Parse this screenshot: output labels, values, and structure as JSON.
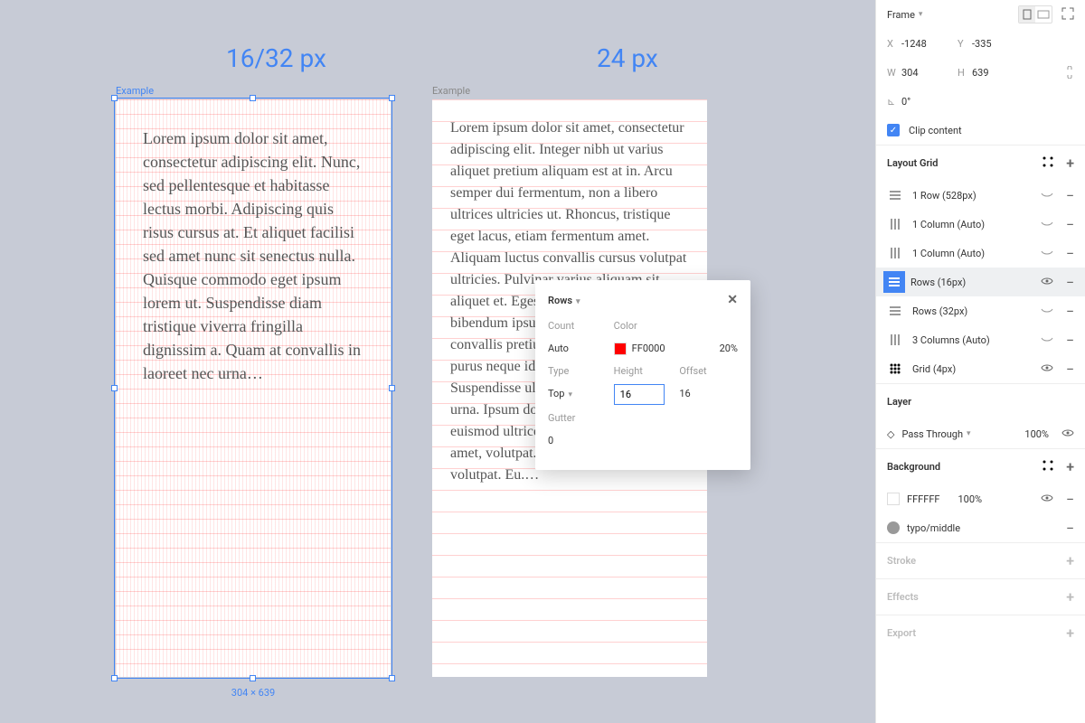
{
  "headings": {
    "left": "16/32 px",
    "right": "24 px"
  },
  "frames": {
    "label": "Example",
    "size_label": "304 × 639",
    "text1": "Lorem ipsum dolor sit amet, consectetur adipiscing elit. Nunc, sed pellentesque et habitasse lectus morbi. Adipiscing quis risus cursus at. Et aliquet facilisi sed amet nunc sit senectus nulla. Quisque commodo eget ipsum lorem ut. Suspendisse diam tristique viverra fringilla dignissim a. Quam at convallis in laoreet nec urna…",
    "text2": "Lorem ipsum dolor sit amet, consectetur adipiscing elit. Integer nibh ut varius aliquet pretium aliquam est at in. Arcu semper dui fermentum, non a libero ultrices ultricies ut. Rhoncus, tristique eget lacus, etiam fermentum amet. Aliquam luctus convallis cursus volutpat ultricies. Pulvinar varius aliquam sit aliquet et. Egestas dignissim orci, morbi bibendum ipsum amet, faucibus est convallis pretium, non suspendisse risus, purus neque id amet sed nam. Suspendisse ultrices gravida lacinia urna. Ipsum dolor eu, orci in fermentum euismod ultrices aenean. Quis dolor at amet, volutpat. Eu. Quis dolor at amet, volutpat. Eu.…"
  },
  "panel": {
    "frame": "Frame",
    "x": "-1248",
    "y": "-335",
    "w": "304",
    "h": "639",
    "angle": "0°",
    "clip": "Clip content",
    "layout_grid": "Layout Grid",
    "grids": [
      {
        "label": "1 Row (528px)",
        "kind": "rows",
        "vis": "closed"
      },
      {
        "label": "1 Column (Auto)",
        "kind": "cols",
        "vis": "closed"
      },
      {
        "label": "1 Column (Auto)",
        "kind": "cols",
        "vis": "closed"
      },
      {
        "label": "Rows (16px)",
        "kind": "rows",
        "vis": "open",
        "sel": true
      },
      {
        "label": "Rows (32px)",
        "kind": "rows",
        "vis": "closed"
      },
      {
        "label": "3 Columns (Auto)",
        "kind": "cols",
        "vis": "closed"
      },
      {
        "label": "Grid (4px)",
        "kind": "grid",
        "vis": "open"
      }
    ],
    "layer": "Layer",
    "pass": "Pass Through",
    "pass_pct": "100%",
    "background": "Background",
    "bg_hex": "FFFFFF",
    "bg_pct": "100%",
    "style_name": "typo/middle",
    "stroke": "Stroke",
    "effects": "Effects",
    "export": "Export"
  },
  "popover": {
    "title": "Rows",
    "labels": {
      "count": "Count",
      "color": "Color",
      "type": "Type",
      "height": "Height",
      "offset": "Offset",
      "gutter": "Gutter"
    },
    "count": "Auto",
    "color_hex": "FF0000",
    "color_pct": "20%",
    "type": "Top",
    "height": "16",
    "offset": "16",
    "gutter": "0"
  }
}
